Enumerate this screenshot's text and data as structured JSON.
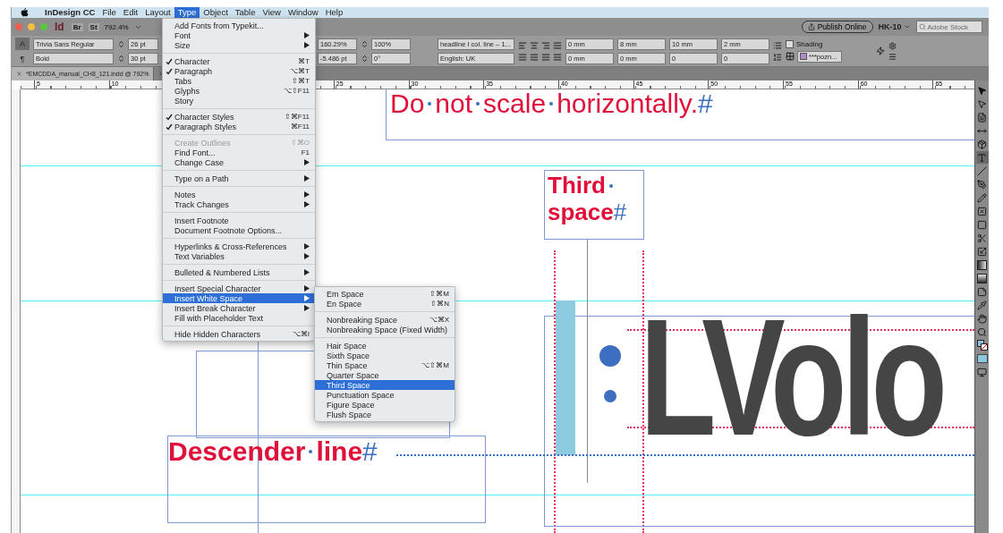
{
  "menu_bar": {
    "app_name": "InDesign CC",
    "items": [
      {
        "label": "File",
        "selected": false
      },
      {
        "label": "Edit",
        "selected": false
      },
      {
        "label": "Layout",
        "selected": false
      },
      {
        "label": "Type",
        "selected": true
      },
      {
        "label": "Object",
        "selected": false
      },
      {
        "label": "Table",
        "selected": false
      },
      {
        "label": "View",
        "selected": false
      },
      {
        "label": "Window",
        "selected": false
      },
      {
        "label": "Help",
        "selected": false
      }
    ]
  },
  "app_bar": {
    "app_logo": "Id",
    "bridge": "Br",
    "stock": "St",
    "zoom": "792.4%",
    "publish": "Publish Online",
    "workspace": "HK-10",
    "search_placeholder": "Adobe Stock"
  },
  "control_panel": {
    "modes": [
      {
        "label": "A",
        "selected": true
      },
      {
        "label": "¶",
        "selected": false
      }
    ],
    "font": "Trivia Sans Regular",
    "style": "Bold",
    "size": "26 pt",
    "leading": "30 pt",
    "vertical_scale": "160.29%",
    "baseline_shift": "-5.486 pt",
    "horizontal_scale": "100%",
    "skew": "0°",
    "paragraph_style": "headline I col. line – 1...",
    "language": "English: UK",
    "left_indent": "0 mm",
    "first_line_indent": "0 mm",
    "right_indent": "8 mm",
    "last_line_indent": "0 mm",
    "space_before": "10 mm",
    "drop_cap_lines": "0",
    "space_after": "2 mm",
    "drop_cap_chars": "0",
    "shading_label": "Shading",
    "shading_checked": false,
    "swatch": "***pozn..."
  },
  "tabs": [
    {
      "label": "*EMCDDA_manual_CH8_121.indd @ 792%",
      "selected": true
    },
    {
      "selected": false
    }
  ],
  "ruler": [
    "5",
    "10",
    "25",
    "30",
    "35",
    "40",
    "45",
    "50",
    "55",
    "60",
    "65"
  ],
  "type_menu": [
    {
      "kind": "item",
      "label": "Add Fonts from Typekit...",
      "checked": false,
      "disabled": false,
      "submenu": false,
      "selected": false
    },
    {
      "kind": "item",
      "label": "Font",
      "checked": false,
      "disabled": false,
      "submenu": true,
      "selected": false
    },
    {
      "kind": "item",
      "label": "Size",
      "checked": false,
      "disabled": false,
      "submenu": true,
      "selected": false
    },
    {
      "kind": "separator"
    },
    {
      "kind": "item",
      "label": "Character",
      "shortcut": "⌘T",
      "checked": true,
      "disabled": false,
      "submenu": false,
      "selected": false
    },
    {
      "kind": "item",
      "label": "Paragraph",
      "shortcut": "⌥⌘T",
      "checked": true,
      "disabled": false,
      "submenu": false,
      "selected": false
    },
    {
      "kind": "item",
      "label": "Tabs",
      "shortcut": "⇧⌘T",
      "checked": false,
      "disabled": false,
      "submenu": false,
      "selected": false
    },
    {
      "kind": "item",
      "label": "Glyphs",
      "shortcut": "⌥⇧F11",
      "checked": false,
      "disabled": false,
      "submenu": false,
      "selected": false
    },
    {
      "kind": "item",
      "label": "Story",
      "checked": false,
      "disabled": false,
      "submenu": false,
      "selected": false
    },
    {
      "kind": "separator"
    },
    {
      "kind": "item",
      "label": "Character Styles",
      "shortcut": "⇧⌘F11",
      "checked": true,
      "disabled": false,
      "submenu": false,
      "selected": false
    },
    {
      "kind": "item",
      "label": "Paragraph Styles",
      "shortcut": "⌘F11",
      "checked": true,
      "disabled": false,
      "submenu": false,
      "selected": false
    },
    {
      "kind": "separator"
    },
    {
      "kind": "item",
      "label": "Create Outlines",
      "shortcut": "⇧⌘O",
      "checked": false,
      "disabled": true,
      "submenu": false,
      "selected": false
    },
    {
      "kind": "item",
      "label": "Find Font...",
      "shortcut": "F1",
      "checked": false,
      "disabled": false,
      "submenu": false,
      "selected": false
    },
    {
      "kind": "item",
      "label": "Change Case",
      "checked": false,
      "disabled": false,
      "submenu": true,
      "selected": false
    },
    {
      "kind": "separator"
    },
    {
      "kind": "item",
      "label": "Type on a Path",
      "checked": false,
      "disabled": false,
      "submenu": true,
      "selected": false
    },
    {
      "kind": "separator"
    },
    {
      "kind": "item",
      "label": "Notes",
      "checked": false,
      "disabled": false,
      "submenu": true,
      "selected": false
    },
    {
      "kind": "item",
      "label": "Track Changes",
      "checked": false,
      "disabled": false,
      "submenu": true,
      "selected": false
    },
    {
      "kind": "separator"
    },
    {
      "kind": "item",
      "label": "Insert Footnote",
      "checked": false,
      "disabled": false,
      "submenu": false,
      "selected": false
    },
    {
      "kind": "item",
      "label": "Document Footnote Options...",
      "checked": false,
      "disabled": false,
      "submenu": false,
      "selected": false
    },
    {
      "kind": "separator"
    },
    {
      "kind": "item",
      "label": "Hyperlinks & Cross-References",
      "checked": false,
      "disabled": false,
      "submenu": true,
      "selected": false
    },
    {
      "kind": "item",
      "label": "Text Variables",
      "checked": false,
      "disabled": false,
      "submenu": true,
      "selected": false
    },
    {
      "kind": "separator"
    },
    {
      "kind": "item",
      "label": "Bulleted & Numbered Lists",
      "checked": false,
      "disabled": false,
      "submenu": true,
      "selected": false
    },
    {
      "kind": "separator"
    },
    {
      "kind": "item",
      "label": "Insert Special Character",
      "checked": false,
      "disabled": false,
      "submenu": true,
      "selected": false
    },
    {
      "kind": "item",
      "label": "Insert White Space",
      "checked": false,
      "disabled": false,
      "submenu": true,
      "selected": true
    },
    {
      "kind": "item",
      "label": "Insert Break Character",
      "checked": false,
      "disabled": false,
      "submenu": true,
      "selected": false
    },
    {
      "kind": "item",
      "label": "Fill with Placeholder Text",
      "checked": false,
      "disabled": false,
      "submenu": false,
      "selected": false
    },
    {
      "kind": "separator"
    },
    {
      "kind": "item",
      "label": "Hide Hidden Characters",
      "shortcut": "⌥⌘I",
      "checked": false,
      "disabled": false,
      "submenu": false,
      "selected": false
    }
  ],
  "white_space_menu": [
    {
      "kind": "item",
      "label": "Em Space",
      "shortcut": "⇧⌘M",
      "selected": false
    },
    {
      "kind": "item",
      "label": "En Space",
      "shortcut": "⇧⌘N",
      "selected": false
    },
    {
      "kind": "separator"
    },
    {
      "kind": "item",
      "label": "Nonbreaking Space",
      "shortcut": "⌥⌘X",
      "selected": false
    },
    {
      "kind": "item",
      "label": "Nonbreaking Space (Fixed Width)",
      "selected": false
    },
    {
      "kind": "separator"
    },
    {
      "kind": "item",
      "label": "Hair Space",
      "selected": false
    },
    {
      "kind": "item",
      "label": "Sixth Space",
      "selected": false
    },
    {
      "kind": "item",
      "label": "Thin Space",
      "shortcut": "⌥⇧⌘M",
      "selected": false
    },
    {
      "kind": "item",
      "label": "Quarter Space",
      "selected": false
    },
    {
      "kind": "item",
      "label": "Third Space",
      "selected": true
    },
    {
      "kind": "item",
      "label": "Punctuation Space",
      "selected": false
    },
    {
      "kind": "item",
      "label": "Figure Space",
      "selected": false
    },
    {
      "kind": "item",
      "label": "Flush Space",
      "selected": false
    }
  ],
  "canvas": {
    "headline": {
      "words": [
        "Do",
        "not",
        "scale",
        "horizontally."
      ],
      "end_mark": "#"
    },
    "third_space": {
      "words": [
        "Third",
        "space"
      ],
      "end_mark": "#"
    },
    "descender": {
      "words": [
        "Descender",
        "line"
      ],
      "end_mark": "#"
    },
    "big_text": "LVolo"
  },
  "tools": [
    {
      "kind": "select",
      "selected": false
    },
    {
      "kind": "direct",
      "selected": false
    },
    {
      "kind": "page",
      "selected": false
    },
    {
      "kind": "gap",
      "selected": false
    },
    {
      "kind": "collector",
      "selected": false
    },
    {
      "kind": "type",
      "selected": true
    },
    {
      "kind": "line",
      "selected": false
    },
    {
      "kind": "pen",
      "selected": false
    },
    {
      "kind": "pencil",
      "selected": false
    },
    {
      "kind": "frame",
      "selected": false
    },
    {
      "kind": "rect",
      "selected": false
    },
    {
      "kind": "scissors",
      "selected": false
    },
    {
      "kind": "transform",
      "selected": false
    },
    {
      "kind": "gradient",
      "selected": false
    },
    {
      "kind": "feather",
      "selected": false
    },
    {
      "kind": "note",
      "selected": false
    },
    {
      "kind": "eyedropper",
      "selected": false
    },
    {
      "kind": "hand",
      "selected": false
    },
    {
      "kind": "zoom",
      "selected": false
    },
    {
      "kind": "fillstroke",
      "selected": false
    },
    {
      "kind": "swatch",
      "selected": false
    },
    {
      "kind": "mode",
      "selected": false
    }
  ]
}
